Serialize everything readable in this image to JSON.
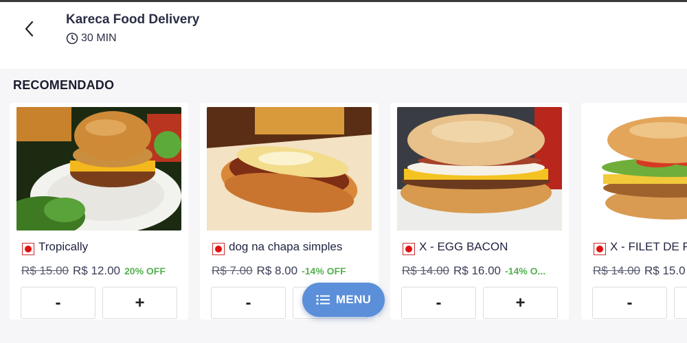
{
  "header": {
    "store_name": "Kareca Food Delivery",
    "eta": "30 MIN",
    "back_icon": "chevron-left-icon",
    "clock_icon": "clock-icon"
  },
  "section": {
    "title": "RECOMENDADO"
  },
  "products": [
    {
      "name": "Tropically",
      "old_price": "R$ 15.00",
      "new_price": "R$ 12.00",
      "discount": "20% OFF",
      "minus": "-",
      "plus": "+"
    },
    {
      "name": "dog na chapa simples",
      "old_price": "R$ 7.00",
      "new_price": "R$ 8.00",
      "discount": "-14% OFF",
      "minus": "-",
      "plus": "+"
    },
    {
      "name": "X - EGG BACON",
      "old_price": "R$ 14.00",
      "new_price": "R$ 16.00",
      "discount": "-14% O...",
      "minus": "-",
      "plus": "+"
    },
    {
      "name": "X - FILET DE F",
      "old_price": "R$ 14.00",
      "new_price": "R$ 15.0",
      "discount": "",
      "minus": "-",
      "plus": "+"
    }
  ],
  "fab": {
    "label": "MENU",
    "icon": "list-icon"
  },
  "colors": {
    "accent": "#5b8fd9",
    "discount": "#54b04e",
    "flag": "#e01010"
  }
}
